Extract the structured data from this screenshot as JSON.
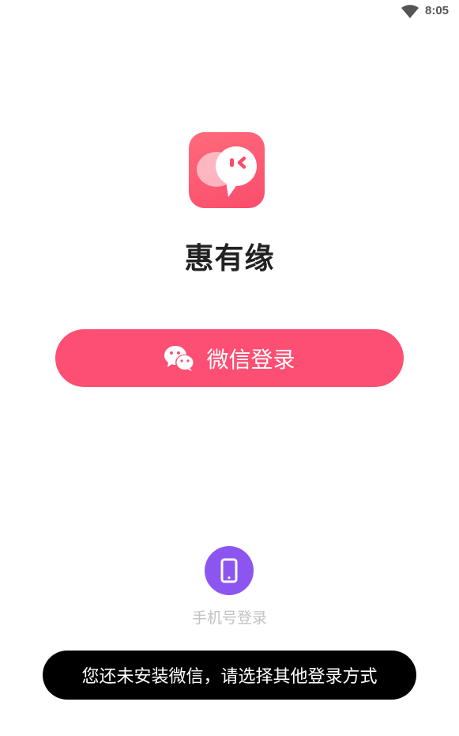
{
  "status_bar": {
    "time": "8:05",
    "wifi_icon": "wifi-icon"
  },
  "app": {
    "name": "惠有缘",
    "logo_icon": "chat-bubbles-logo",
    "brand_color": "#fc4f73"
  },
  "login": {
    "wechat_label": "微信登录",
    "wechat_icon": "wechat-icon",
    "wechat_button_color": "#fc4f73",
    "phone_label": "手机号登录",
    "phone_icon": "smartphone-icon",
    "phone_button_color": "#8d55f0"
  },
  "toast": {
    "message": "您还未安装微信，请选择其他登录方式"
  }
}
